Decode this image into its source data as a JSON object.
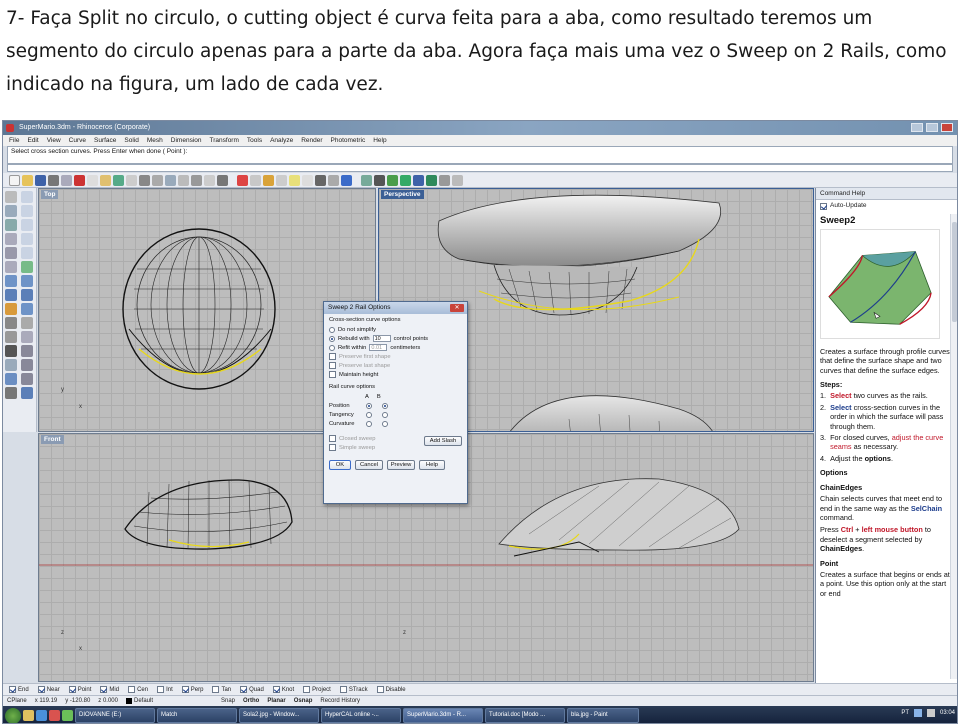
{
  "caption": "7- Faça Split no circulo, o cutting object é curva feita para a aba, como resultado teremos um segmento do circulo apenas para a parte da aba. Agora faça mais uma vez o Sweep on 2 Rails, como indicado na figura, um lado de cada vez.",
  "window": {
    "title": "SuperMario.3dm - Rhinoceros (Corporate)"
  },
  "menu": [
    "File",
    "Edit",
    "View",
    "Curve",
    "Surface",
    "Solid",
    "Mesh",
    "Dimension",
    "Transform",
    "Tools",
    "Analyze",
    "Render",
    "Photometric",
    "Help"
  ],
  "command": {
    "prompt": "Select cross section curves. Press Enter when done ( Point ):"
  },
  "viewports": {
    "top": "Top",
    "perspective": "Perspective",
    "front": "Front"
  },
  "dialog": {
    "title": "Sweep 2 Rail Options",
    "group1": "Cross-section curve options",
    "do_not_simplify": "Do not simplify",
    "rebuild_with": "Rebuild with",
    "rebuild_value": "10",
    "control_points": "control points",
    "refit_within": "Refit within",
    "refit_value": "0.01",
    "centimeters": "centimeters",
    "preserve_first": "Preserve first shape",
    "preserve_last": "Preserve last shape",
    "maintain_height": "Maintain height",
    "group2": "Rail curve options",
    "col_a": "A",
    "col_b": "B",
    "position": "Position",
    "tangency": "Tangency",
    "curvature": "Curvature",
    "closed_sweep": "Closed sweep",
    "simple_sweep": "Simple sweep",
    "add_slash": "Add Slash",
    "ok": "OK",
    "cancel": "Cancel",
    "preview": "Preview",
    "help": "Help"
  },
  "help_panel": {
    "header": "Command Help",
    "auto_update": "Auto-Update",
    "title": "Sweep2",
    "intro": "Creates a surface through profile curves that define the surface shape and two curves that define the surface edges.",
    "steps_title": "Steps:",
    "step1_num": "1.",
    "step1_a": "Select",
    "step1_b": " two curves as the rails.",
    "step2_num": "2.",
    "step2_a": "Select",
    "step2_b": " cross-section curves in the order in which the surface will pass through them.",
    "step3_num": "3.",
    "step3_a": "For closed curves, ",
    "step3_b": "adjust the curve seams",
    "step3_c": " as necessary.",
    "step4_num": "4.",
    "step4_a": "Adjust the ",
    "step4_b": "options",
    "step4_c": ".",
    "options_title": "Options",
    "chain_title": "ChainEdges",
    "chain_text_a": "Chain selects curves that meet end to end in the same way as the ",
    "chain_text_b": "SelChain",
    "chain_text_c": " command.",
    "chain_text2_a": "Press ",
    "chain_text2_b": "Ctrl",
    "chain_text2_c": " + ",
    "chain_text2_d": "left mouse button",
    "chain_text2_e": " to deselect a segment selected by ",
    "chain_text2_f": "ChainEdges",
    "chain_text2_g": ".",
    "point_title": "Point",
    "point_text": "Creates a surface that begins or ends at a point. Use this option only at the start or end"
  },
  "osnap": [
    "End",
    "Near",
    "Point",
    "Mid",
    "Cen",
    "Int",
    "Perp",
    "Tan",
    "Quad",
    "Knot",
    "Project",
    "STrack",
    "Disable"
  ],
  "osnap_checked": [
    true,
    true,
    true,
    true,
    false,
    false,
    true,
    false,
    true,
    true,
    false,
    false,
    false
  ],
  "status": {
    "cplane": "CPlane",
    "x": "x 119.19",
    "y": "y -120.80",
    "z": "z 0.000",
    "layer": "Default",
    "snap": "Snap",
    "ortho": "Ortho",
    "planar": "Planar",
    "osnap": "Osnap",
    "history": "Record History"
  },
  "taskbar": {
    "items": [
      "DIOVANNE (E:)",
      "Match",
      "Sola2.jpg - Window...",
      "HyperCAL online -...",
      "SuperMario.3dm - R...",
      "Tutorial.doc [Modo ...",
      "bla.jpg - Paint"
    ],
    "lang": "PT",
    "clock": "03:04"
  },
  "colors": {
    "viewport_bg": "#bdbdbd",
    "active_label": "#3b5f95",
    "selection": "#e8d81a",
    "help_red": "#c0182a",
    "help_blue": "#1d3d8c"
  }
}
